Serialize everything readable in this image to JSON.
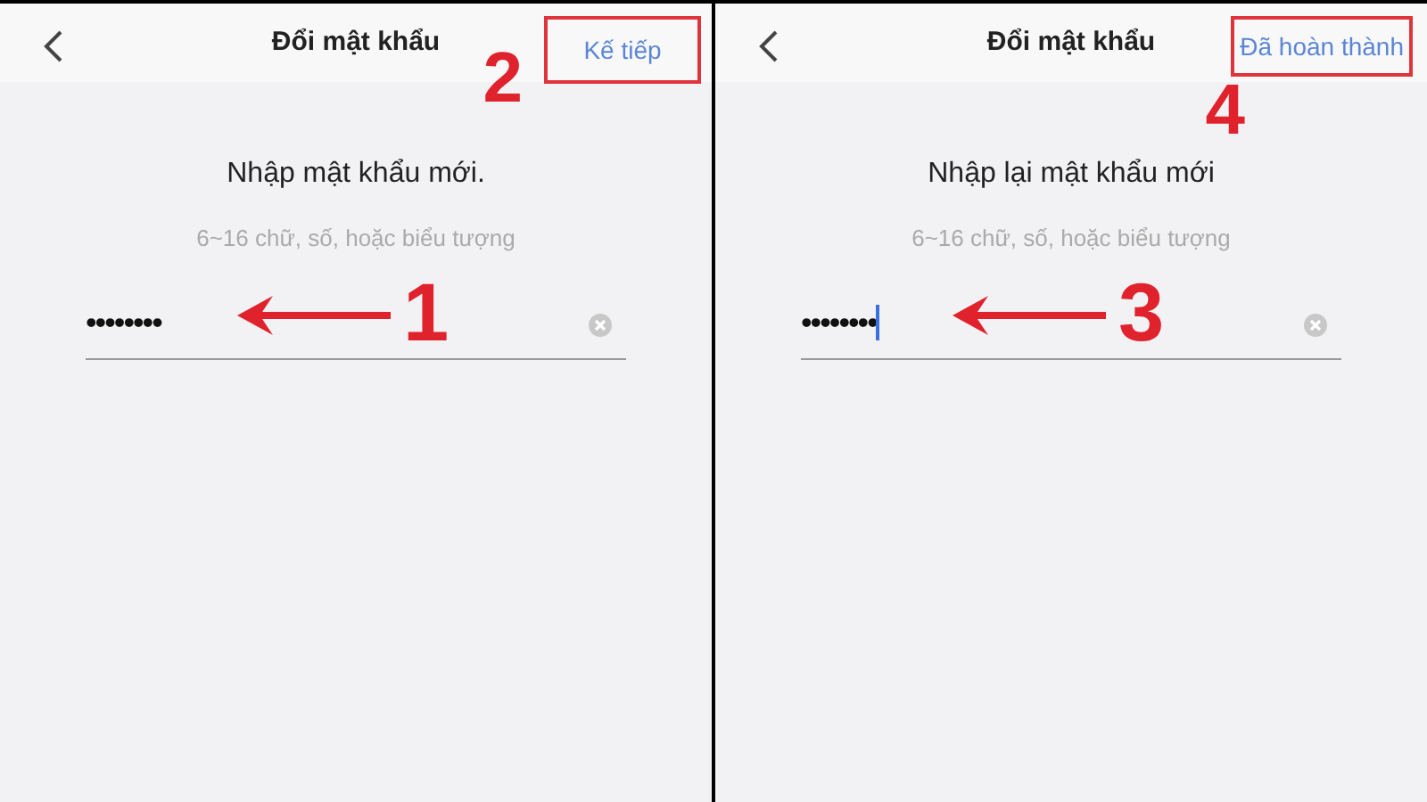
{
  "panels": [
    {
      "title": "Đổi mật khẩu",
      "action": "Kế tiếp",
      "heading": "Nhập mật khẩu mới.",
      "hint": "6~16 chữ, số, hoặc biểu tượng",
      "password": "••••••••",
      "cursor": false,
      "field_step": "1",
      "action_step": "2"
    },
    {
      "title": "Đổi mật khẩu",
      "action": "Đã hoàn thành",
      "heading": "Nhập lại mật khẩu mới",
      "hint": "6~16 chữ, số, hoặc biểu tượng",
      "password": "••••••••",
      "cursor": true,
      "field_step": "3",
      "action_step": "4"
    }
  ]
}
